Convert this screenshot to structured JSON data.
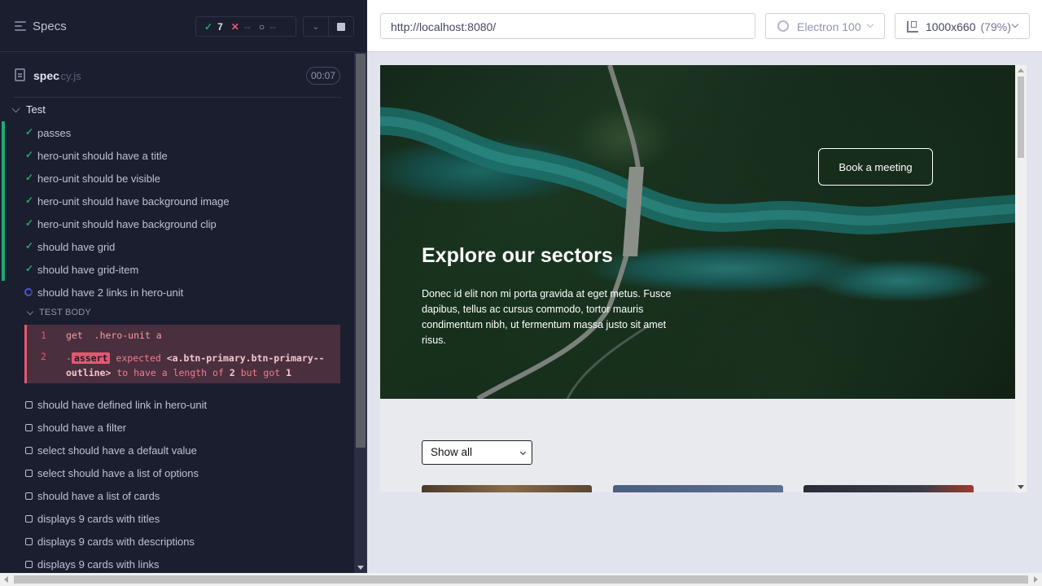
{
  "reporter": {
    "header": {
      "title": "Specs",
      "stats": {
        "passed": "7",
        "failed": "--",
        "pending": "--"
      }
    },
    "spec": {
      "name": "spec",
      "ext": ".cy.js",
      "duration": "00:07"
    },
    "suite": {
      "title": "Test"
    },
    "tests": [
      {
        "label": "passes",
        "state": "passed"
      },
      {
        "label": "hero-unit should have a title",
        "state": "passed"
      },
      {
        "label": "hero-unit should be visible",
        "state": "passed"
      },
      {
        "label": "hero-unit should have background image",
        "state": "passed"
      },
      {
        "label": "hero-unit should have background clip",
        "state": "passed"
      },
      {
        "label": "should have grid",
        "state": "passed"
      },
      {
        "label": "should have grid-item",
        "state": "passed"
      },
      {
        "label": "should have 2 links in hero-unit",
        "state": "running"
      }
    ],
    "test_body": {
      "header": "TEST BODY",
      "commands": [
        {
          "num": "1",
          "name": "get",
          "arg": ".hero-unit a"
        },
        {
          "num": "2",
          "prefix": "-",
          "name": "assert",
          "msg_pre": "expected",
          "msg_sel": "<a.btn-primary.btn-primary--outline>",
          "msg_mid": "to have a length of",
          "msg_exp": "2",
          "msg_mid2": "but got",
          "msg_act": "1"
        }
      ]
    },
    "pending_tests": [
      "should have defined link in hero-unit",
      "should have a filter",
      "select should have a default value",
      "select should have a list of options",
      "should have a list of cards",
      "displays 9 cards with titles",
      "displays 9 cards with descriptions",
      "displays 9 cards with links"
    ]
  },
  "toolbar": {
    "url": "http://localhost:8080/",
    "browser": "Electron 100",
    "viewport": "1000x660",
    "zoom": "(79%)"
  },
  "aut": {
    "hero": {
      "title": "Explore our sectors",
      "description": "Donec id elit non mi porta gravida at eget metus. Fusce dapibus, tellus ac cursus commodo, tortor mauris condimentum nibh, ut fermentum massa justo sit amet risus.",
      "button": "Book a meeting"
    },
    "filter": {
      "selected": "Show all"
    }
  },
  "colors": {
    "pass": "#1fa971",
    "fail": "#e45770",
    "running": "#4956e3",
    "reporter_bg": "#1b1e2e"
  }
}
